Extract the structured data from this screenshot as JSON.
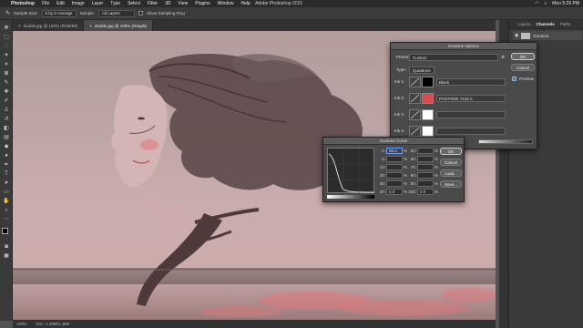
{
  "menubar": {
    "app": "Photoshop",
    "items": [
      "File",
      "Edit",
      "Image",
      "Layer",
      "Type",
      "Select",
      "Filter",
      "3D",
      "View",
      "Plugins",
      "Window",
      "Help"
    ],
    "window_title": "Adobe Photoshop 2021",
    "clock": "Mon 5:26 PM"
  },
  "options": {
    "sample_size_label": "Sample Size:",
    "sample_size": "5 by 5 Average",
    "sample_label": "Sample:",
    "sample": "All Layers",
    "show_ring": "Show Sampling Ring"
  },
  "tabs": [
    {
      "label": "double.jpg @ 100% (RGB/8#)"
    },
    {
      "label": "double.jpg @ 100% (Gray/8)"
    }
  ],
  "status": {
    "zoom": "100%",
    "doc": "Doc: 1.49M/1.48M"
  },
  "right_panel": {
    "tabs": [
      "Layers",
      "Channels",
      "Paths"
    ],
    "channel_name": "Duotone"
  },
  "duotone": {
    "title": "Duotone Options",
    "preset_label": "Preset:",
    "preset": "Custom",
    "type_label": "Type:",
    "type": "Quadtone",
    "inks": [
      {
        "label": "Ink 1:",
        "name": "Black",
        "color": "#000000"
      },
      {
        "label": "Ink 2:",
        "name": "PANTONE 7418 C",
        "color": "#d94a52"
      },
      {
        "label": "Ink 3:",
        "name": "",
        "color": "#ffffff"
      },
      {
        "label": "Ink 4:",
        "name": "",
        "color": "#ffffff"
      }
    ],
    "ok": "OK",
    "cancel": "Cancel",
    "preview": "Preview"
  },
  "curve": {
    "title": "Duotone Curve",
    "left_labels": [
      "0:",
      "5:",
      "10:",
      "20:",
      "30:",
      "40:"
    ],
    "left_values": [
      "86.3",
      "",
      "",
      "",
      "",
      "0.0"
    ],
    "right_labels": [
      "50:",
      "60:",
      "70:",
      "80:",
      "90:",
      "100:"
    ],
    "right_values": [
      "",
      "",
      "",
      "",
      "",
      "0.0"
    ],
    "pct": "%",
    "ok": "OK",
    "cancel": "Cancel",
    "load": "Load...",
    "save": "Save..."
  }
}
